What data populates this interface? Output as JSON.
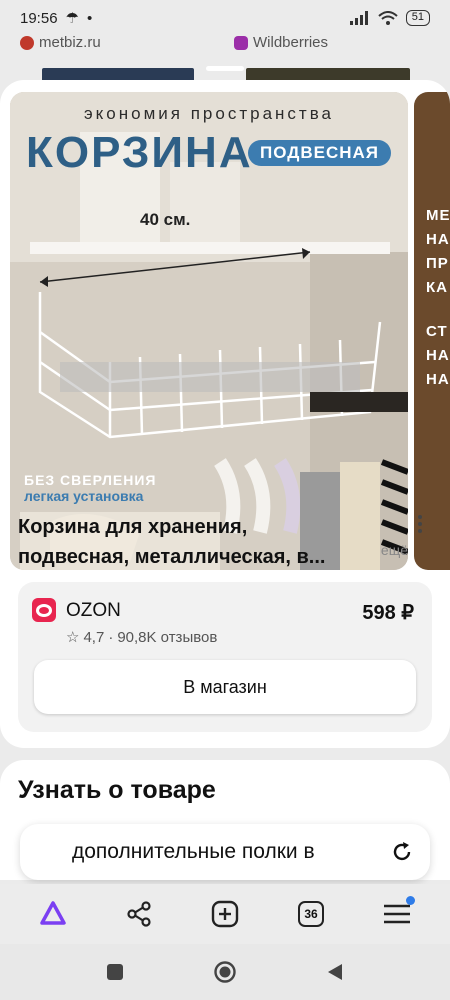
{
  "status": {
    "time": "19:56",
    "battery": "51"
  },
  "background": {
    "site_left": "metbiz.ru",
    "site_right": "Wildberries"
  },
  "product": {
    "image_text": {
      "top": "экономия пространства",
      "title": "КОРЗИНА",
      "badge": "ПОДВЕСНАЯ",
      "dimension": "40 см.",
      "feature1": "БЕЗ СВЕРЛЕНИЯ",
      "feature2": "легкая установка"
    },
    "side_image_text": [
      "МЕ",
      "НА",
      "ПР",
      "КА",
      "",
      "СТ",
      "НА",
      "НА"
    ],
    "title_line1": "Корзина для хранения,",
    "title_line2": "подвесная, металлическая, в...",
    "more_label": "ещё"
  },
  "offer": {
    "shop": "OZON",
    "price": "598 ₽",
    "rating": "4,7",
    "reviews": "90,8K отзывов",
    "button": "В магазин",
    "brand_color": "#e8254f"
  },
  "learn": {
    "title": "Узнать о товаре"
  },
  "search": {
    "query": "дополнительные полки в"
  },
  "browser": {
    "tabs_count": "36",
    "accent": "#7b3ff2"
  }
}
